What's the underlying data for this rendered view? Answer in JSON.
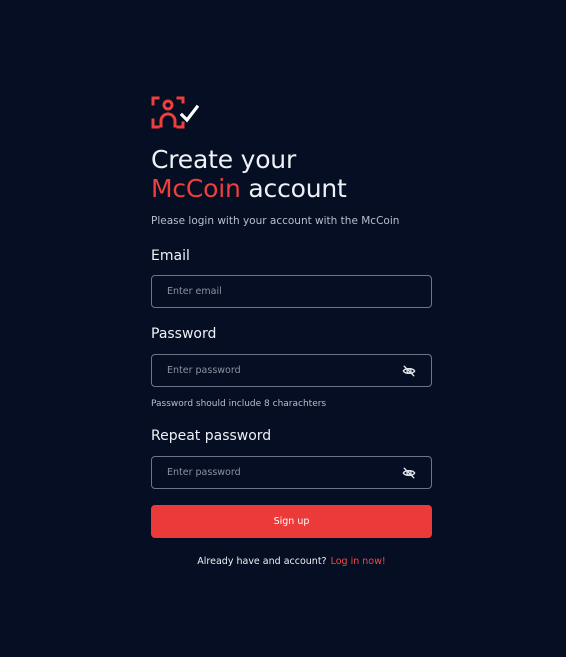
{
  "brand": {
    "accent_color": "#ef3f3d",
    "background_color": "#050e22",
    "logo_icon": "user-verify-icon"
  },
  "heading": {
    "line1": "Create your",
    "brand_name": "McCoin",
    "line2_rest": " account"
  },
  "subtitle": "Please login with your account with the McCoin",
  "email": {
    "label": "Email",
    "placeholder": "Enter email"
  },
  "password": {
    "label": "Password",
    "placeholder": "Enter password",
    "hint": "Password should include 8 charachters",
    "toggle_icon": "eye-off-icon"
  },
  "repeat_password": {
    "label": "Repeat password",
    "placeholder": "Enter password",
    "toggle_icon": "eye-off-icon"
  },
  "signup_button": {
    "label": "Sign up"
  },
  "footer": {
    "text": "Already have and account?",
    "login_link": "Log in now!"
  }
}
